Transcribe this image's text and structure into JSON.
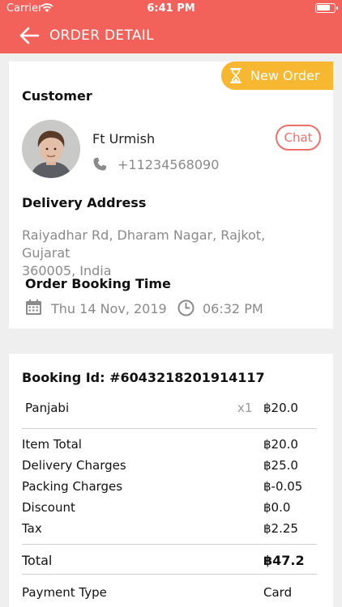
{
  "status_bar": {
    "carrier": "Carrier",
    "time": "6:41 PM"
  },
  "header": {
    "title": "ORDER DETAIL"
  },
  "order": {
    "status_badge": "New Order",
    "customer_heading": "Customer",
    "customer_name": "Ft Urmish",
    "customer_phone": "+11234568090",
    "chat_label": "Chat",
    "delivery_heading": "Delivery Address",
    "delivery_address_line1": "Raiyadhar Rd, Dharam Nagar, Rajkot, Gujarat",
    "delivery_address_line2": "360005, India",
    "booking_time_heading": "Order Booking Time",
    "booking_date": "Thu 14 Nov, 2019",
    "booking_time": "06:32 PM"
  },
  "bill": {
    "booking_id_label": "Booking Id: #6043218201914117",
    "items": [
      {
        "name": "Panjabi",
        "qty": "x1",
        "price": "฿20.0"
      }
    ],
    "charges": [
      {
        "label": "Item Total",
        "value": "฿20.0"
      },
      {
        "label": "Delivery Charges",
        "value": "฿25.0"
      },
      {
        "label": "Packing Charges",
        "value": "฿-0.05"
      },
      {
        "label": "Discount",
        "value": "฿0.0"
      },
      {
        "label": "Tax",
        "value": "฿2.25"
      }
    ],
    "total_label": "Total",
    "total_value": "฿47.2",
    "payment_type_label": "Payment Type",
    "payment_type_value": "Card"
  },
  "colors": {
    "header": "#f2625b",
    "badge": "#f7b731",
    "chat_accent": "#ef6f6a",
    "background": "#efefef"
  },
  "icons": [
    "wifi-icon",
    "battery-icon",
    "back-arrow-icon",
    "hourglass-icon",
    "phone-icon",
    "calendar-icon",
    "clock-icon"
  ]
}
